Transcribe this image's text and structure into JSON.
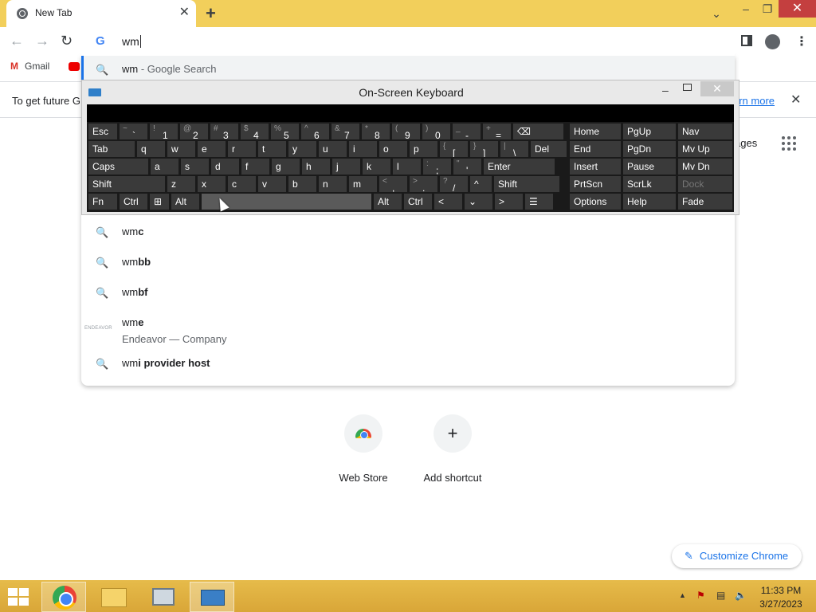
{
  "browser": {
    "tab_title": "New Tab",
    "tab_close": "✕",
    "new_tab": "+",
    "tab_list": "⌄",
    "minimize": "–",
    "maximize": "❐",
    "close": "✕"
  },
  "toolbar": {
    "back": "←",
    "forward": "→",
    "reload": "↻",
    "omnibox_logo": "G",
    "omnibox_text": "wm",
    "menu": "⋮"
  },
  "bookmarks": {
    "gmail_icon": "M",
    "gmail_label": "Gmail"
  },
  "infobar": {
    "text_visible": "To get future G",
    "learn_more_visible": "arn more",
    "close": "✕"
  },
  "ntp": {
    "images_link_visible": "ages",
    "shortcuts": [
      {
        "label": "Web Store"
      },
      {
        "label": "Add shortcut",
        "icon_text": "+"
      }
    ],
    "customize_label": "Customize Chrome",
    "customize_icon": "✎"
  },
  "omnibox_dropdown": {
    "search_icon": "🔍",
    "suggestions": [
      {
        "typed": "wm",
        "rest": "",
        "suffix": " - Google Search"
      },
      {
        "typed": "wm",
        "rest": "c"
      },
      {
        "typed": "wm",
        "rest": "bb"
      },
      {
        "typed": "wm",
        "rest": "bf"
      },
      {
        "typed": "wm",
        "rest": "e",
        "subtitle": "Endeavor — Company",
        "logo_text": "ENDEAVOR"
      },
      {
        "typed": "wm",
        "rest": "i provider host"
      }
    ]
  },
  "osk": {
    "title": "On-Screen Keyboard",
    "minimize": "–",
    "close": "✕",
    "rows": {
      "row1": [
        {
          "main": "Esc"
        },
        {
          "shift": "~",
          "main": "`"
        },
        {
          "shift": "!",
          "main": "1"
        },
        {
          "shift": "@",
          "main": "2"
        },
        {
          "shift": "#",
          "main": "3"
        },
        {
          "shift": "$",
          "main": "4"
        },
        {
          "shift": "%",
          "main": "5"
        },
        {
          "shift": "^",
          "main": "6"
        },
        {
          "shift": "&",
          "main": "7"
        },
        {
          "shift": "*",
          "main": "8"
        },
        {
          "shift": "(",
          "main": "9"
        },
        {
          "shift": ")",
          "main": "0"
        },
        {
          "shift": "_",
          "main": "-"
        },
        {
          "shift": "+",
          "main": "="
        },
        {
          "main": "⌫"
        }
      ],
      "row2": [
        {
          "main": "Tab"
        },
        {
          "main": "q"
        },
        {
          "main": "w"
        },
        {
          "main": "e"
        },
        {
          "main": "r"
        },
        {
          "main": "t"
        },
        {
          "main": "y"
        },
        {
          "main": "u"
        },
        {
          "main": "i"
        },
        {
          "main": "o"
        },
        {
          "main": "p"
        },
        {
          "shift": "{",
          "main": "["
        },
        {
          "shift": "}",
          "main": "]"
        },
        {
          "shift": "|",
          "main": "\\"
        },
        {
          "main": "Del"
        }
      ],
      "row3": [
        {
          "main": "Caps"
        },
        {
          "main": "a"
        },
        {
          "main": "s"
        },
        {
          "main": "d"
        },
        {
          "main": "f"
        },
        {
          "main": "g"
        },
        {
          "main": "h"
        },
        {
          "main": "j"
        },
        {
          "main": "k"
        },
        {
          "main": "l"
        },
        {
          "shift": ":",
          "main": ";"
        },
        {
          "shift": "\"",
          "main": "'"
        },
        {
          "main": "Enter"
        }
      ],
      "row4": [
        {
          "main": "Shift"
        },
        {
          "main": "z"
        },
        {
          "main": "x"
        },
        {
          "main": "c"
        },
        {
          "main": "v"
        },
        {
          "main": "b"
        },
        {
          "main": "n"
        },
        {
          "main": "m"
        },
        {
          "shift": "<",
          "main": ","
        },
        {
          "shift": ">",
          "main": "."
        },
        {
          "shift": "?",
          "main": "/"
        },
        {
          "main": "^"
        },
        {
          "main": "Shift"
        }
      ],
      "row5": [
        {
          "main": "Fn"
        },
        {
          "main": "Ctrl"
        },
        {
          "main": "⊞"
        },
        {
          "main": "Alt"
        },
        {
          "main": ""
        },
        {
          "main": "Alt"
        },
        {
          "main": "Ctrl"
        },
        {
          "main": "<"
        },
        {
          "main": "⌄"
        },
        {
          "main": ">"
        },
        {
          "main": "☰"
        }
      ]
    },
    "nav_keys": [
      [
        "Home",
        "PgUp",
        "Nav"
      ],
      [
        "End",
        "PgDn",
        "Mv Up"
      ],
      [
        "Insert",
        "Pause",
        "Mv Dn"
      ],
      [
        "PrtScn",
        "ScrLk",
        "Dock"
      ],
      [
        "Options",
        "Help",
        "Fade"
      ]
    ]
  },
  "taskbar": {
    "tray_arrow": "▲",
    "tray_flag": "⚑",
    "tray_network": "▤",
    "tray_volume": "🔈",
    "time": "11:33 PM",
    "date": "3/27/2023"
  }
}
